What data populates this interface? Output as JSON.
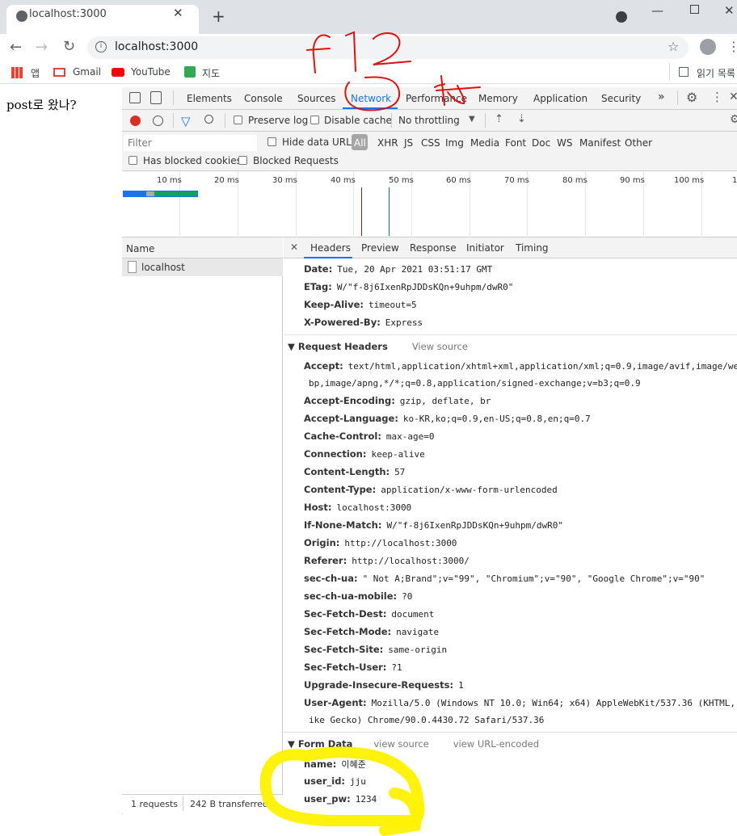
{
  "browser": {
    "tab_title": "localhost:3000",
    "address": "localhost:3000",
    "bookmarks": [
      "앱",
      "Gmail",
      "YouTube",
      "지도"
    ],
    "reading_list": "읽기 목록"
  },
  "page": {
    "text": "post로 왔나?"
  },
  "devtools": {
    "tabs": [
      "Elements",
      "Console",
      "Sources",
      "Network",
      "Performance",
      "Memory",
      "Application",
      "Security"
    ],
    "active_tab": "Network",
    "toolbar": {
      "preserve_log": "Preserve log",
      "disable_cache": "Disable cache",
      "throttling": "No throttling"
    },
    "filter": {
      "placeholder": "Filter",
      "hide_data_urls": "Hide data URLs",
      "types": [
        "All",
        "XHR",
        "JS",
        "CSS",
        "Img",
        "Media",
        "Font",
        "Doc",
        "WS",
        "Manifest",
        "Other"
      ],
      "has_blocked_cookies": "Has blocked cookies",
      "blocked_requests": "Blocked Requests"
    },
    "timeline_ticks": [
      "10 ms",
      "20 ms",
      "30 ms",
      "40 ms",
      "50 ms",
      "60 ms",
      "70 ms",
      "80 ms",
      "90 ms",
      "100 ms",
      "1"
    ],
    "name_header": "Name",
    "requests": [
      "localhost"
    ],
    "status": {
      "requests": "1 requests",
      "transferred": "242 B transferred"
    },
    "detail_tabs": [
      "Headers",
      "Preview",
      "Response",
      "Initiator",
      "Timing"
    ],
    "response_headers": [
      {
        "k": "Date:",
        "v": "Tue, 20 Apr 2021 03:51:17 GMT"
      },
      {
        "k": "ETag:",
        "v": "W/\"f-8j6IxenRpJDDsKQn+9uhpm/dwR0\""
      },
      {
        "k": "Keep-Alive:",
        "v": "timeout=5"
      },
      {
        "k": "X-Powered-By:",
        "v": "Express"
      }
    ],
    "request_headers_title": "▼ Request Headers",
    "view_source": "View source",
    "request_headers": [
      {
        "k": "Accept:",
        "v": "text/html,application/xhtml+xml,application/xml;q=0.9,image/avif,image/we"
      },
      {
        "k": "",
        "v": "bp,image/apng,*/*;q=0.8,application/signed-exchange;v=b3;q=0.9"
      },
      {
        "k": "Accept-Encoding:",
        "v": "gzip, deflate, br"
      },
      {
        "k": "Accept-Language:",
        "v": "ko-KR,ko;q=0.9,en-US;q=0.8,en;q=0.7"
      },
      {
        "k": "Cache-Control:",
        "v": "max-age=0"
      },
      {
        "k": "Connection:",
        "v": "keep-alive"
      },
      {
        "k": "Content-Length:",
        "v": "57"
      },
      {
        "k": "Content-Type:",
        "v": "application/x-www-form-urlencoded"
      },
      {
        "k": "Host:",
        "v": "localhost:3000"
      },
      {
        "k": "If-None-Match:",
        "v": "W/\"f-8j6IxenRpJDDsKQn+9uhpm/dwR0\""
      },
      {
        "k": "Origin:",
        "v": "http://localhost:3000"
      },
      {
        "k": "Referer:",
        "v": "http://localhost:3000/"
      },
      {
        "k": "sec-ch-ua:",
        "v": "\" Not A;Brand\";v=\"99\", \"Chromium\";v=\"90\", \"Google Chrome\";v=\"90\""
      },
      {
        "k": "sec-ch-ua-mobile:",
        "v": "?0"
      },
      {
        "k": "Sec-Fetch-Dest:",
        "v": "document"
      },
      {
        "k": "Sec-Fetch-Mode:",
        "v": "navigate"
      },
      {
        "k": "Sec-Fetch-Site:",
        "v": "same-origin"
      },
      {
        "k": "Sec-Fetch-User:",
        "v": "?1"
      },
      {
        "k": "Upgrade-Insecure-Requests:",
        "v": "1"
      },
      {
        "k": "User-Agent:",
        "v": "Mozilla/5.0 (Windows NT 10.0; Win64; x64) AppleWebKit/537.36 (KHTML, l"
      },
      {
        "k": "",
        "v": "ike Gecko) Chrome/90.0.4430.72 Safari/537.36"
      }
    ],
    "form_data_title": "▼ Form Data",
    "form_view_source": "view source",
    "form_view_url": "view URL-encoded",
    "form_data": [
      {
        "k": "name:",
        "v": "이혜준"
      },
      {
        "k": "user_id:",
        "v": "jju"
      },
      {
        "k": "user_pw:",
        "v": "1234"
      }
    ]
  },
  "annotation": {
    "handwriting": "f12"
  }
}
